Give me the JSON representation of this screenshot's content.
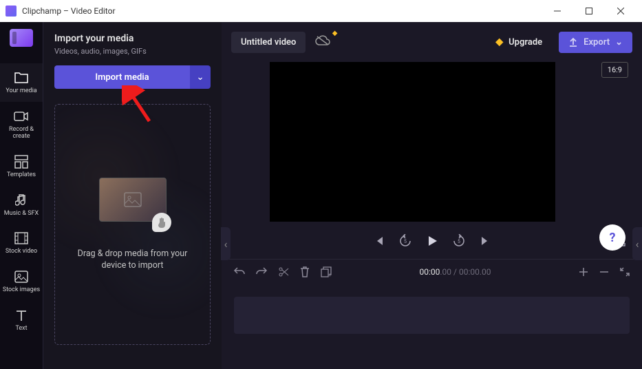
{
  "window": {
    "title": "Clipchamp – Video Editor",
    "minimize": "—",
    "maximize": "☐",
    "close": "✕"
  },
  "rail": {
    "items": [
      {
        "label": "Your media",
        "icon": "folder"
      },
      {
        "label": "Record & create",
        "icon": "camera"
      },
      {
        "label": "Templates",
        "icon": "template"
      },
      {
        "label": "Music & SFX",
        "icon": "music"
      },
      {
        "label": "Stock video",
        "icon": "film"
      },
      {
        "label": "Stock images",
        "icon": "image"
      },
      {
        "label": "Text",
        "icon": "text"
      }
    ]
  },
  "mediaPanel": {
    "title": "Import your media",
    "subtitle": "Videos, audio, images, GIFs",
    "importBtn": "Import media",
    "dropText": "Drag & drop media from your device to import"
  },
  "editor": {
    "projectTitle": "Untitled video",
    "upgrade": "Upgrade",
    "export": "Export",
    "aspectRatio": "16:9",
    "timecode": {
      "current": "00:00",
      "currentFrac": ".00",
      "total": "00:00",
      "totalFrac": ".00"
    }
  },
  "icons": {
    "chevronDown": "⌄",
    "chevronLeft": "‹",
    "upload": "⬆",
    "gem": "◆",
    "help": "?"
  }
}
